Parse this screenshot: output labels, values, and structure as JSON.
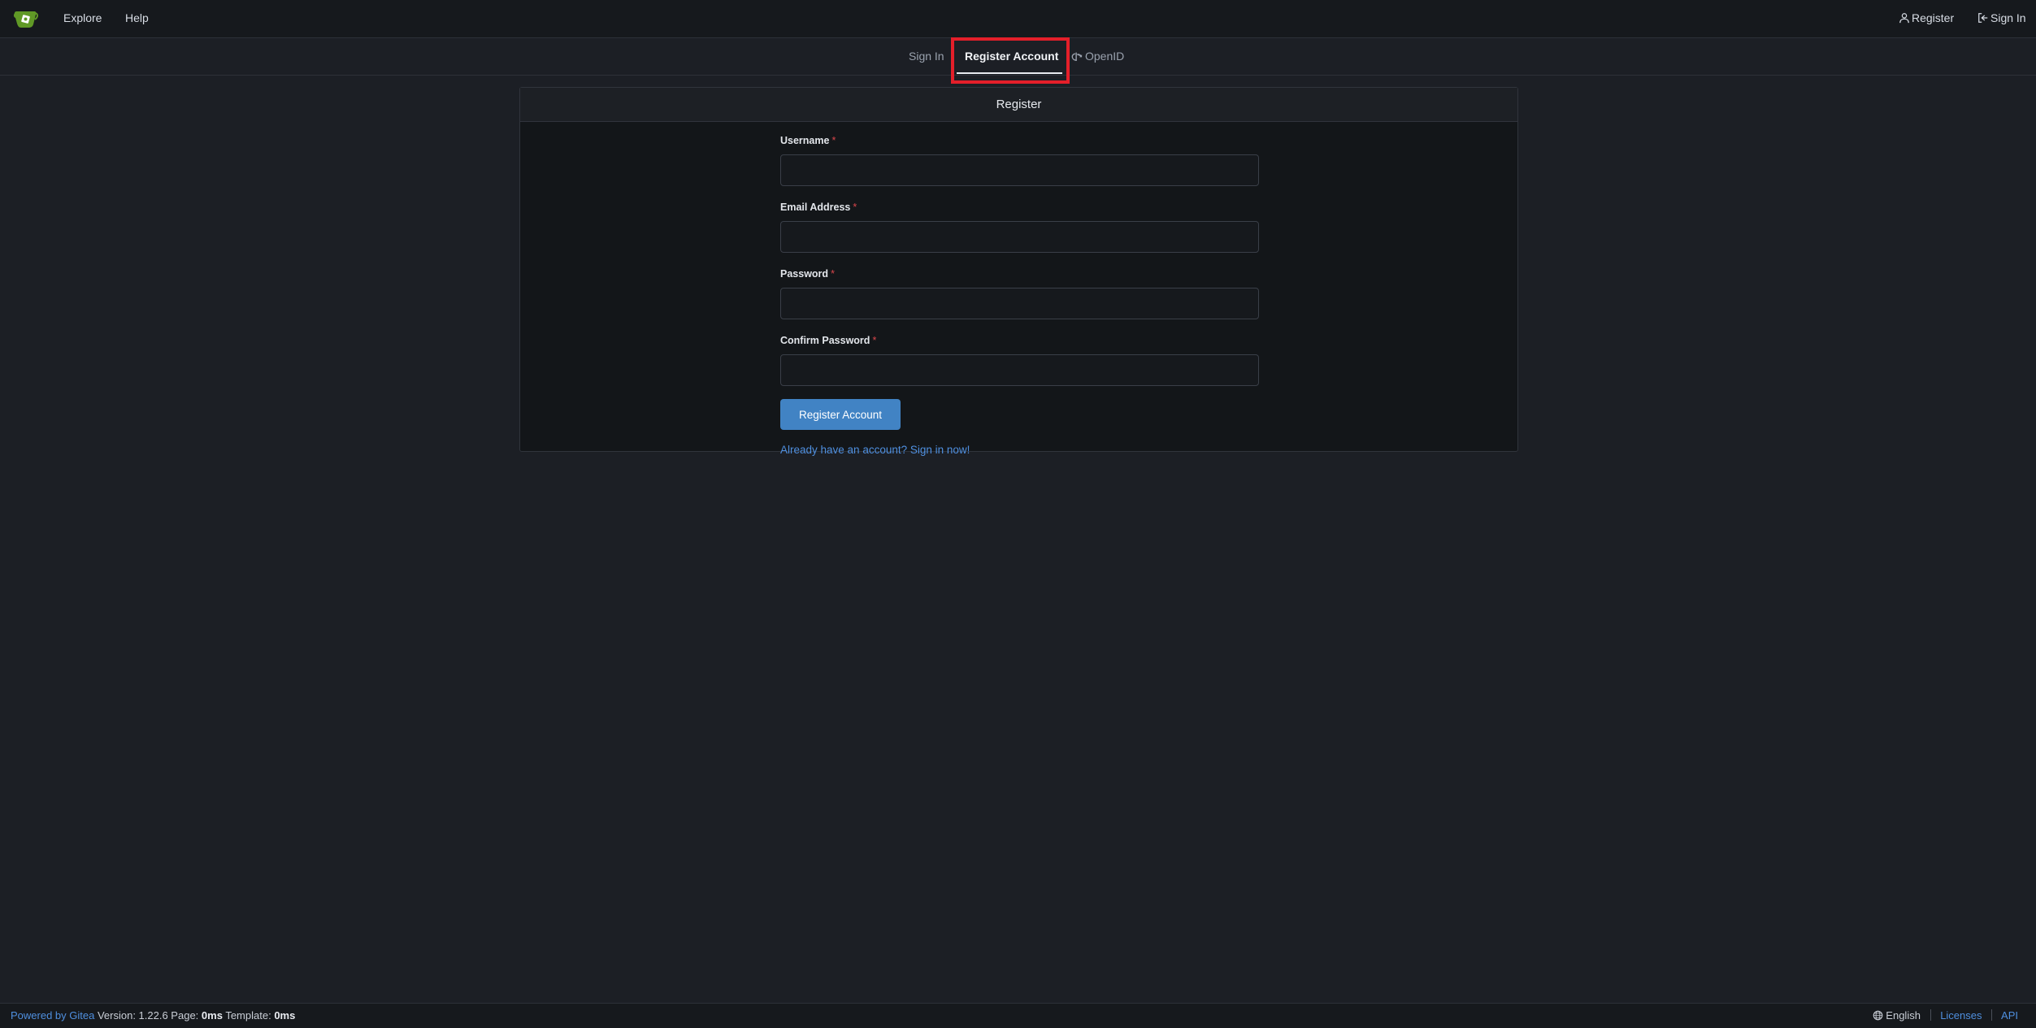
{
  "navbar": {
    "explore": "Explore",
    "help": "Help",
    "register": "Register",
    "sign_in": "Sign In"
  },
  "tabs": {
    "sign_in": "Sign In",
    "register_account": "Register Account",
    "openid": "OpenID"
  },
  "card": {
    "title": "Register",
    "fields": {
      "username": {
        "label": "Username",
        "value": ""
      },
      "email": {
        "label": "Email Address",
        "value": ""
      },
      "password": {
        "label": "Password",
        "value": ""
      },
      "confirm_password": {
        "label": "Confirm Password",
        "value": ""
      }
    },
    "required_marker": "*",
    "submit_label": "Register Account",
    "signin_link": "Already have an account? Sign in now!"
  },
  "footer": {
    "powered_by": "Powered by Gitea",
    "version_label": "Version: 1.22.6 Page:",
    "page_time": "0ms",
    "template_label": "Template:",
    "template_time": "0ms",
    "language": "English",
    "licenses": "Licenses",
    "api": "API"
  },
  "colors": {
    "accent": "#4183c4",
    "link": "#4f8fdf",
    "highlight": "#e41f2a",
    "logo": "#609926"
  }
}
